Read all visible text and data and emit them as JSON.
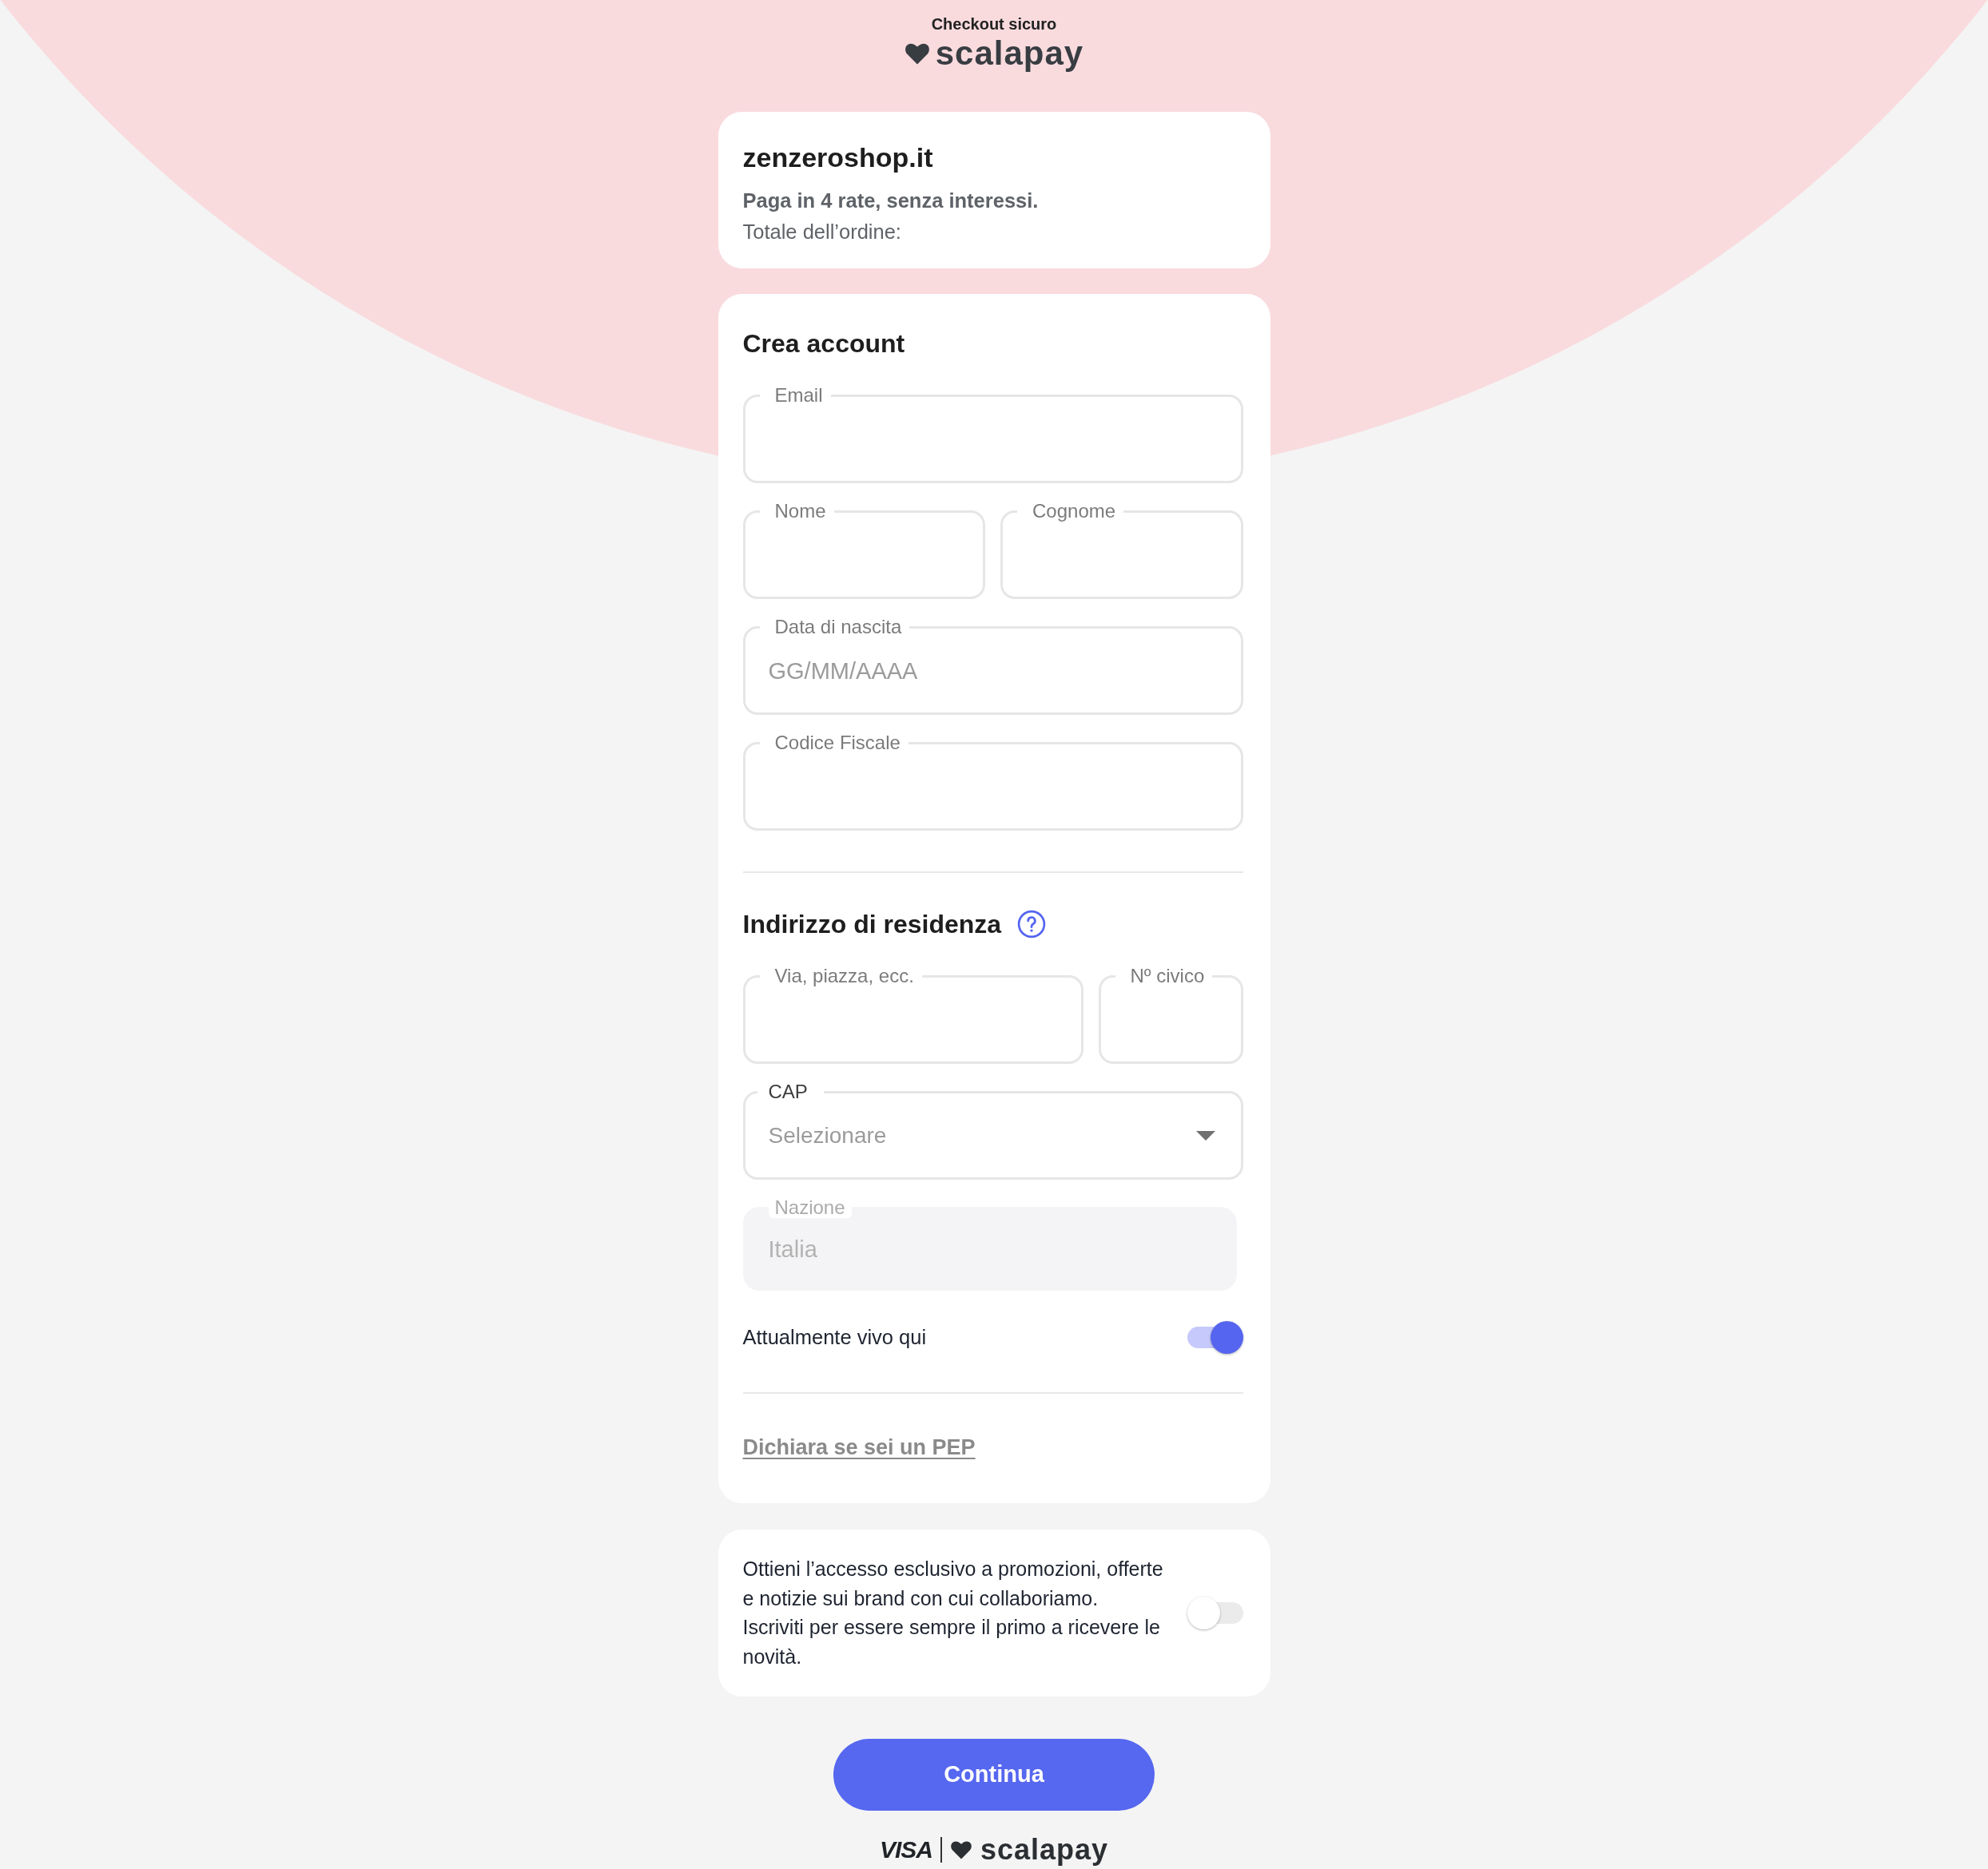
{
  "header": {
    "caption": "Checkout sicuro",
    "brand": "scalapay"
  },
  "order_summary": {
    "merchant": "zenzeroshop.it",
    "offer": "Paga in 4 rate, senza interessi.",
    "total_label": "Totale dell’ordine:"
  },
  "account_form": {
    "title": "Crea account",
    "rows": [
      [
        {
          "kind": "text",
          "label": "Email",
          "disabled": false
        }
      ],
      [
        {
          "kind": "text",
          "label": "Nome",
          "disabled": false
        },
        {
          "kind": "text",
          "label": "Cognome",
          "disabled": false
        }
      ],
      [
        {
          "kind": "text",
          "label": "Data di nascita",
          "placeholder": "GG/MM/AAAA",
          "disabled": false
        }
      ],
      [
        {
          "kind": "text",
          "label": "Codice Fiscale",
          "disabled": false
        }
      ]
    ]
  },
  "address_form": {
    "title": "Indirizzo di residenza",
    "rows": [
      [
        {
          "kind": "text",
          "label": "Via, piazza, ecc.",
          "disabled": false
        },
        {
          "kind": "text",
          "label": "Nº civico",
          "disabled": false
        }
      ],
      [
        {
          "kind": "select",
          "label": "CAP",
          "placeholder": "Selezionare",
          "disabled": false
        }
      ],
      [
        {
          "kind": "text",
          "label": "Nazione",
          "value": "Italia",
          "disabled": true
        }
      ]
    ],
    "lives_here": {
      "label": "Attualmente vivo qui",
      "on": true
    },
    "pep_link": "Dichiara se sei un PEP"
  },
  "newsletter": {
    "sentences": [
      "Ottieni l’accesso esclusivo a promozioni, offerte e notizie sui brand con cui collaboriamo.",
      "Iscriviti per essere sempre il primo a ricevere le novità."
    ],
    "on": false
  },
  "continue_button": "Continua",
  "footer": {
    "card_brand": "VISA",
    "brand": "scalapay"
  }
}
